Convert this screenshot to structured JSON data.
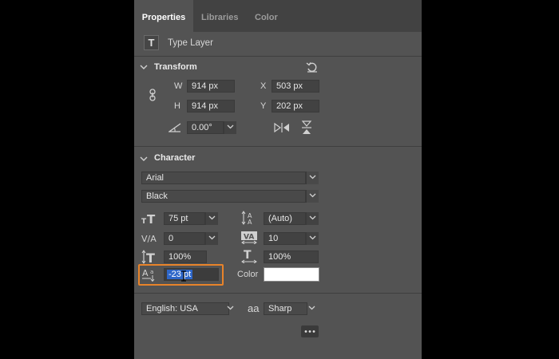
{
  "tabs": [
    {
      "label": "Properties"
    },
    {
      "label": "Libraries"
    },
    {
      "label": "Color"
    }
  ],
  "layer": {
    "kind_label": "Type Layer",
    "icon_glyph": "T"
  },
  "transform": {
    "title": "Transform",
    "w_label": "W",
    "w_value": "914 px",
    "h_label": "H",
    "h_value": "914 px",
    "x_label": "X",
    "x_value": "503 px",
    "y_label": "Y",
    "y_value": "202 px",
    "angle_value": "0.00°"
  },
  "character": {
    "title": "Character",
    "font_family": "Arial",
    "font_style": "Black",
    "font_size": "75 pt",
    "leading": "(Auto)",
    "kerning": "0",
    "tracking": "10",
    "vertical_scale": "100%",
    "horizontal_scale": "100%",
    "baseline_shift": "-23 pt",
    "color_label": "Color",
    "color_value": "#ffffff",
    "language": "English: USA",
    "antialias_icon_text": "aa",
    "antialias": "Sharp"
  },
  "colors": {
    "highlight_border": "#e8832a",
    "selection": "#2e66c8"
  }
}
